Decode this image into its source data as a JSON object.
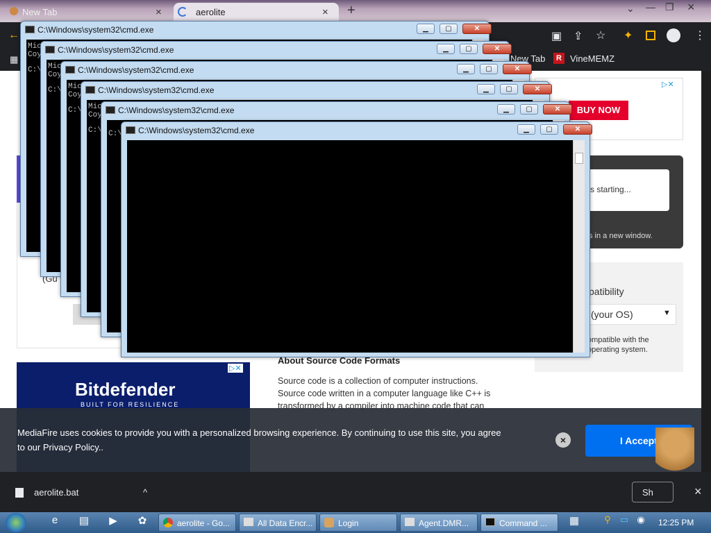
{
  "browser": {
    "tabs": [
      {
        "label": "New Tab",
        "close": "×"
      },
      {
        "label": "aerolite",
        "close": "×"
      }
    ],
    "new_tab": "+",
    "window_controls": {
      "minimize": "⌄",
      "restore": "—",
      "maximize": "❐",
      "close": "×"
    },
    "bookmarks": [
      {
        "label": "New Tab"
      },
      {
        "label": "VineMEMZ"
      }
    ]
  },
  "page": {
    "ad_buy_now": "BUY NOW",
    "download_status": "s starting...",
    "download_hint": "s in a new window.",
    "partial_left": "(Gu",
    "compat_heading": "patibility",
    "compat_select": "(your OS)",
    "compat_note_1": "ompatible with the",
    "compat_note_2": "operating system.",
    "about_heading": "About Source Code Formats",
    "about_text_1": "Source code is a collection of computer instructions.",
    "about_text_2": "Source code written in a computer language like C++ is",
    "about_text_3": "transformed by a compiler into machine code that can",
    "bitdefender_logo": "Bitdefender",
    "bitdefender_tag": "BUILT FOR RESILIENCE"
  },
  "cookie": {
    "text_1": "MediaFire uses cookies to provide you with a personalized browsing experience. By continuing to use this site, you agree",
    "text_2": "to our Privacy Policy..",
    "accept": "I Accept",
    "close": "×"
  },
  "shelf": {
    "file_name": "aerolite.bat",
    "chevron": "^",
    "show_all": "Sh",
    "close": "×"
  },
  "cmd_windows": [
    {
      "title": "C:\\Windows\\system32\\cmd.exe",
      "line1": "Mic",
      "line2": "Coy",
      "line3": "C:\\"
    },
    {
      "title": "C:\\Windows\\system32\\cmd.exe",
      "line1": "Mic",
      "line2": "Coy",
      "line3": "C:\\"
    },
    {
      "title": "C:\\Windows\\system32\\cmd.exe",
      "line1": "Mic",
      "line2": "Coy",
      "line3": "C:\\"
    },
    {
      "title": "C:\\Windows\\system32\\cmd.exe",
      "line1": "Mic",
      "line2": "Coy",
      "line3": "C:\\"
    },
    {
      "title": "C:\\Windows\\system32\\cmd.exe",
      "line1": "",
      "line2": "",
      "line3": "C:\\"
    },
    {
      "title": "C:\\Windows\\system32\\cmd.exe",
      "line1": "",
      "line2": "",
      "line3": ""
    }
  ],
  "taskbar": {
    "items": [
      {
        "label": "aerolite - Go..."
      },
      {
        "label": "All Data Encr..."
      },
      {
        "label": "Login"
      },
      {
        "label": "Agent.DMR..."
      },
      {
        "label": "Command ..."
      }
    ],
    "clock": "12:25 PM"
  }
}
